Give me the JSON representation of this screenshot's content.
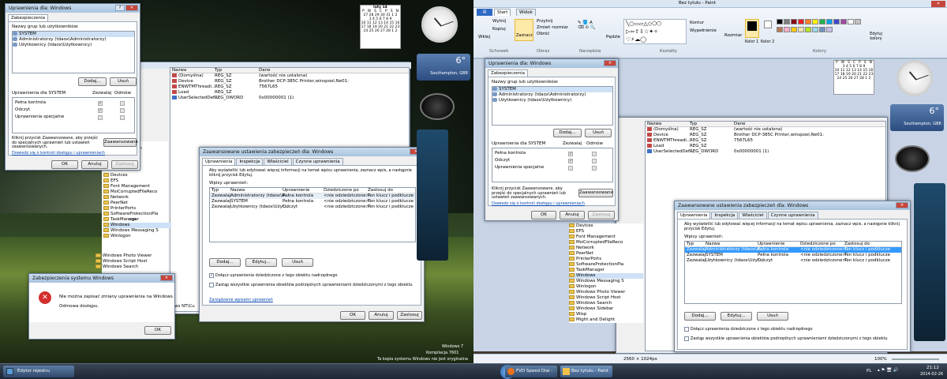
{
  "colors": {
    "accent": "#3399ff",
    "titlebar": "#a8c3dd",
    "close": "#c7463b",
    "link": "#0645ad",
    "error": "#d32f2f"
  },
  "left": {
    "perm_win": {
      "title": "Uprawnienia dla: Windows",
      "tab": "Zabezpieczenia",
      "groups_label": "Nazwy grup lub użytkowników:",
      "users": [
        "SYSTEM",
        "Administratorzy (tdaox\\Administratorzy)",
        "Użytkownicy (tdaox\\Użytkownicy)"
      ],
      "add": "Dodaj...",
      "remove": "Usuń",
      "perms_for": "Uprawnienia dla SYSTEM",
      "allow": "Zezwalaj",
      "deny": "Odmów",
      "perms": [
        {
          "name": "Pełna kontrola",
          "allow": true,
          "deny": false
        },
        {
          "name": "Odczyt",
          "allow": true,
          "deny": false
        },
        {
          "name": "Uprawnienia specjalne",
          "allow": false,
          "deny": false
        }
      ],
      "note": "Kliknij przycisk Zaawansowane, aby przejść do specjalnych uprawnień lub ustawień zaawansowanych.",
      "advanced": "Zaawansowane",
      "learn": "Dowiedz się o kontroli dostępu i uprawnieniach",
      "ok": "OK",
      "cancel": "Anuluj",
      "apply": "Zastosuj"
    },
    "regedit": {
      "cols": [
        "Nazwa",
        "Typ",
        "Dane"
      ],
      "rows": [
        {
          "icon": "reg",
          "name": "(Domyślna)",
          "type": "REG_SZ",
          "data": "(wartość nie ustalona)"
        },
        {
          "icon": "reg",
          "name": "Device",
          "type": "REG_SZ",
          "data": "Brother DCP-385C Printer,winspool,Ne01:"
        },
        {
          "icon": "reg",
          "name": "ENWTMThreadi...",
          "type": "REG_SZ",
          "data": "7567L65"
        },
        {
          "icon": "reg",
          "name": "Load",
          "type": "REG_SZ",
          "data": ""
        },
        {
          "icon": "regb",
          "name": "UserSelectedDef...",
          "type": "REG_DWORD",
          "data": "0x00000001 (1)"
        }
      ],
      "tree": [
        "Devices",
        "EFS",
        "Font Management",
        "MsiCorruptedFileReco",
        "Network",
        "PeerNet",
        "PrinterPorts",
        "SoftwareProtectionPla",
        "TaskManager",
        "Windows",
        "Windows Messaging S",
        "Winlogon"
      ],
      "tree2": [
        "Windows Photo Viewer",
        "Windows Script Host",
        "Windows Search"
      ],
      "partial": [
        "ndation",
        "gs",
        "ngs"
      ],
      "status_path": "ws NT\\Cu"
    },
    "adv_win": {
      "title": "Zaawansowane ustawienia zabezpieczeń dla: Windows",
      "tabs": [
        "Uprawnienia",
        "Inspekcja",
        "Właściciel",
        "Czynne uprawnienia"
      ],
      "info": "Aby wyświetlić lub edytować więcej informacji na temat wpisu uprawnienia, zaznacz wpis, a następnie kliknij przycisk Edytuj.",
      "entries_label": "Wpisy uprawnień:",
      "cols": [
        "Typ",
        "Nazwa",
        "Uprawnienie",
        "Dziedziczone po",
        "Zastosuj do"
      ],
      "rows": [
        {
          "t": "Zezwalaj",
          "n": "Administratorzy (tdaox\\A...",
          "p": "Pełna kontrola",
          "i": "<nie odziedziczone>",
          "a": "Ten klucz i podklucze"
        },
        {
          "t": "Zezwalaj",
          "n": "SYSTEM",
          "p": "Pełna kontrola",
          "i": "<nie odziedziczone>",
          "a": "Ten klucz i podklucze"
        },
        {
          "t": "Zezwalaj",
          "n": "Użytkownicy (tdaox\\Użyt...",
          "p": "Odczyt",
          "i": "<nie odziedziczone>",
          "a": "Ten klucz i podklucze"
        }
      ],
      "add": "Dodaj...",
      "edit": "Edytuj...",
      "remove": "Usuń",
      "inherit": "Dołącz uprawnienia dziedziczone z tego obiektu nadrzędnego",
      "replace": "Zastąp wszystkie uprawnienia obiektów podrzędnych uprawnieniami dziedziczonymi z tego obiektu",
      "manage": "Zarządzanie wpisami uprawnień",
      "ok": "OK",
      "cancel": "Anuluj",
      "apply": "Zastosuj"
    },
    "error_win": {
      "title": "Zabezpieczenia systemu Windows",
      "line1": "Nie można zapisać zmiany uprawnienia na Windows.",
      "line2": "Odmowa dostępu.",
      "ok": "OK"
    },
    "calendar": {
      "month": "luty 14",
      "days": [
        "P",
        "W",
        "Ś",
        "C",
        "P",
        "S",
        "N"
      ],
      "rows": [
        "27 28 29 30 31 1 2",
        "3 4 5 6 7 8 9",
        "10 11 12 13 14 15 16",
        "17 18 19 20 21 22 23",
        "24 25 26 27 28 1 2"
      ]
    },
    "weather": {
      "temp": "6°",
      "city": "Southampton, GBR"
    },
    "watermark": [
      "Windows 7",
      "Kompilacja 7601",
      "Ta kopia systemu Windows nie jest oryginalna"
    ],
    "taskbar_item": "Edytor rejestru"
  },
  "right": {
    "paint_title": "Bez tytułu - Paint",
    "ribbon_tabs": [
      "Start",
      "Widok"
    ],
    "clipboard": [
      "Wklej",
      "Wytnij",
      "Kopiuj"
    ],
    "image_grp": [
      "Zaznacz",
      "Przytnij",
      "Zmień rozmiar",
      "Obróć"
    ],
    "groups": [
      "Schowek",
      "Obraz",
      "Narzędzia",
      "Kształty",
      "Kolory"
    ],
    "brushes": "Pędzle",
    "outline": "Kontur",
    "fill": "Wypełnienie",
    "size": "Rozmiar",
    "color1": "Kolor 1",
    "color2": "Kolor 2",
    "edit_colors": "Edytuj kolory",
    "palette": [
      "#000000",
      "#7f7f7f",
      "#880015",
      "#ed1c24",
      "#ff7f27",
      "#fff200",
      "#22b14c",
      "#00a2e8",
      "#3f48cc",
      "#a349a4",
      "#ffffff",
      "#c3c3c3",
      "#b97a57",
      "#ffaec9",
      "#ffc90e",
      "#efe4b0",
      "#b5e61d",
      "#99d9ea",
      "#7092be",
      "#c8bfe7"
    ],
    "tree_extra": [
      "Windows Sidebar",
      "Wisp",
      "Might and Delight"
    ],
    "status_size": "2560 × 1024px",
    "zoom": "100%",
    "tray_lang": "PL",
    "time": "21:12",
    "date": "2014-02-26",
    "taskbar_items": [
      "FVD Speed Dial - ...",
      "Bez tytułu - Paint"
    ]
  }
}
